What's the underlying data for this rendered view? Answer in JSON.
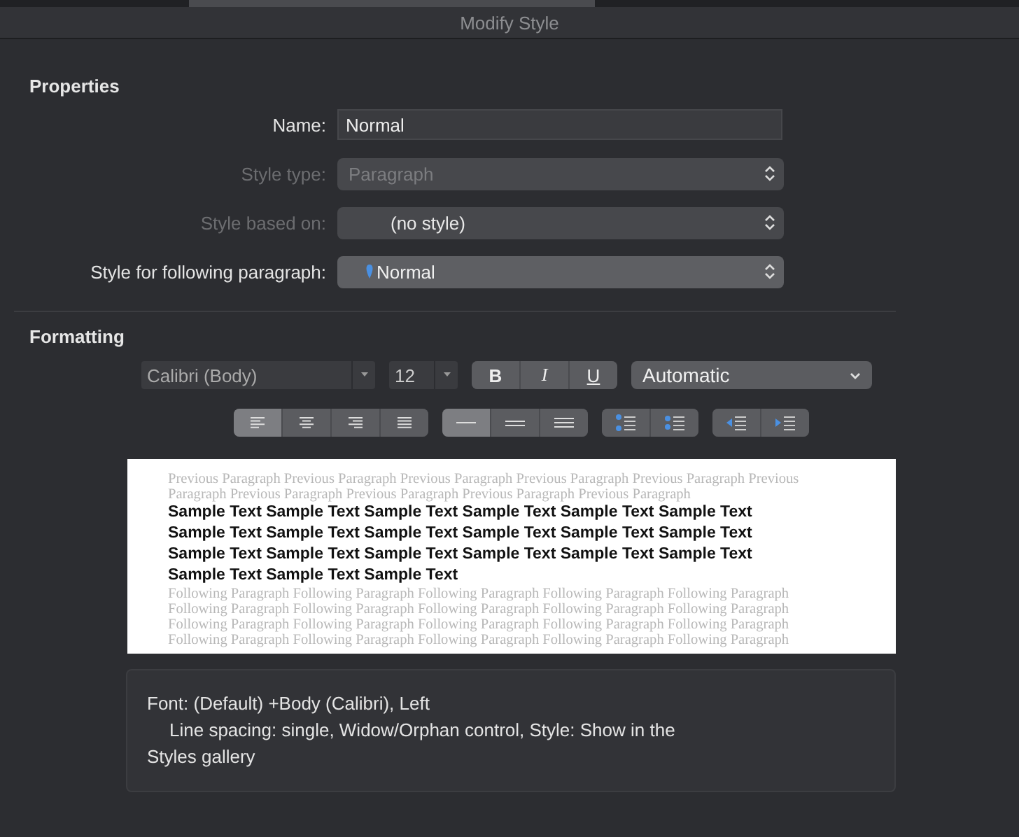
{
  "window": {
    "title": "Modify Style"
  },
  "properties": {
    "heading": "Properties",
    "fields": [
      {
        "kind": "text",
        "label": "Name:",
        "value": "Normal",
        "disabled": false
      },
      {
        "kind": "popup",
        "label": "Style type:",
        "value": "Paragraph",
        "disabled": true,
        "style_icon": false
      },
      {
        "kind": "popup",
        "label": "Style based on:",
        "value": "(no style)",
        "disabled": true,
        "style_icon": false
      },
      {
        "kind": "popup",
        "label": "Style for following paragraph:",
        "value": "Normal",
        "disabled": false,
        "style_icon": true
      }
    ]
  },
  "formatting": {
    "heading": "Formatting",
    "font": "Calibri (Body)",
    "size": "12",
    "styles": [
      {
        "label": "B",
        "kind": "bold",
        "selected": false
      },
      {
        "label": "I",
        "kind": "italic",
        "selected": false
      },
      {
        "label": "U",
        "kind": "underline",
        "selected": false
      }
    ],
    "color_label": "Automatic",
    "alignment": [
      {
        "kind": "left",
        "selected": true
      },
      {
        "kind": "center",
        "selected": false
      },
      {
        "kind": "right",
        "selected": false
      },
      {
        "kind": "justify",
        "selected": false
      }
    ],
    "spacing": [
      {
        "kind": "single",
        "selected": true
      },
      {
        "kind": "one-half",
        "selected": false
      },
      {
        "kind": "double",
        "selected": false
      }
    ],
    "paragraph_spacing": [
      {
        "kind": "decrease"
      },
      {
        "kind": "increase"
      }
    ],
    "indent": [
      {
        "kind": "decrease"
      },
      {
        "kind": "increase"
      }
    ]
  },
  "preview": {
    "previous": "Previous Paragraph Previous Paragraph Previous Paragraph Previous Paragraph Previous Paragraph Previous Paragraph Previous Paragraph Previous Paragraph Previous Paragraph Previous Paragraph",
    "sample": "Sample Text Sample Text Sample Text Sample Text Sample Text Sample Text Sample Text Sample Text Sample Text Sample Text Sample Text Sample Text Sample Text Sample Text Sample Text Sample Text Sample Text Sample Text Sample Text Sample Text Sample Text",
    "following": [
      "Following Paragraph Following Paragraph Following Paragraph Following Paragraph Following Paragraph",
      "Following Paragraph Following Paragraph Following Paragraph Following Paragraph Following Paragraph",
      "Following Paragraph Following Paragraph Following Paragraph Following Paragraph Following Paragraph",
      "Following Paragraph Following Paragraph Following Paragraph Following Paragraph Following Paragraph"
    ]
  },
  "description": [
    "Font: (Default) +Body (Calibri), Left",
    "Line spacing:  single, Widow/Orphan control, Style: Show in the",
    "Styles gallery"
  ]
}
